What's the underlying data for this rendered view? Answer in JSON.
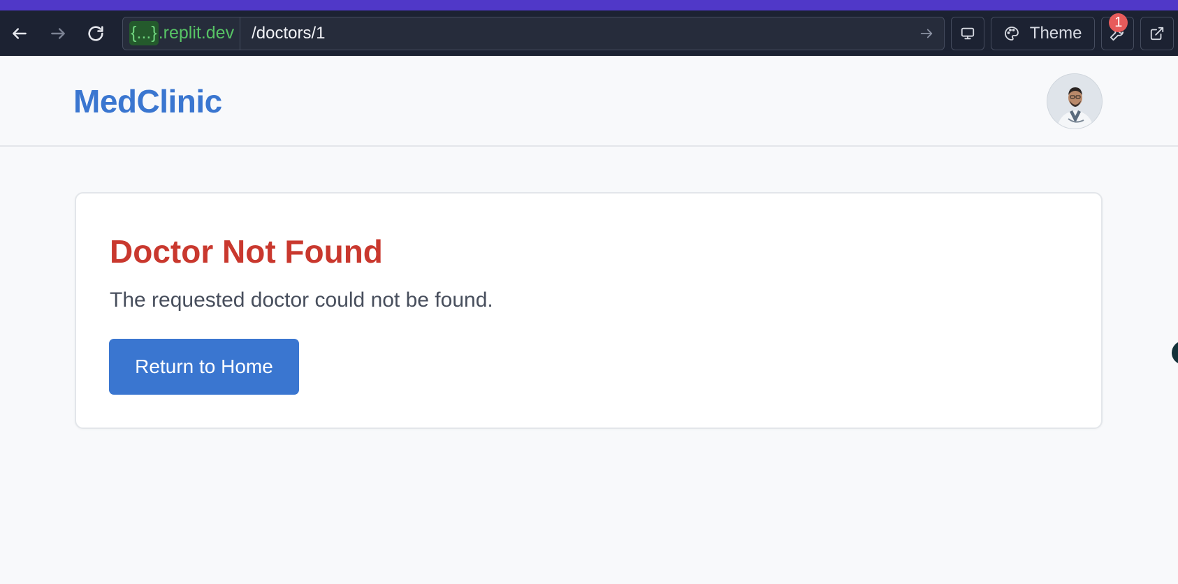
{
  "browser": {
    "url_domain_token": "{...}",
    "url_domain_suffix": ".replit.dev",
    "url_path": "/doctors/1",
    "theme_label": "Theme",
    "devtools_badge": "1"
  },
  "header": {
    "brand": "MedClinic",
    "avatar_alt": "Doctor avatar"
  },
  "main": {
    "title": "Doctor Not Found",
    "message": "The requested doctor could not be found.",
    "return_label": "Return to Home"
  },
  "colors": {
    "accent": "#3a76d0",
    "error": "#c9382e",
    "browser_bar": "#1c2232",
    "top_accent": "#5038c8"
  },
  "icons": {
    "back": "arrow-left-icon",
    "forward": "arrow-right-icon",
    "reload": "reload-icon",
    "go": "arrow-right-icon",
    "device": "monitor-icon",
    "theme": "palette-icon",
    "devtools": "wrench-icon",
    "open": "external-link-icon"
  }
}
